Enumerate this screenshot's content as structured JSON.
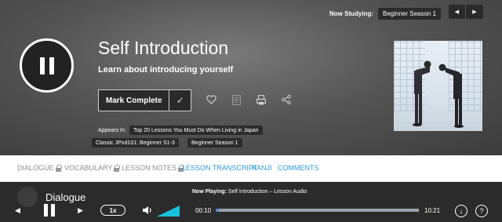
{
  "header": {
    "now_studying_label": "Now Studying:",
    "now_studying_value": "Beginner Season 1",
    "prev_icon": "chevron-left-icon",
    "next_icon": "chevron-right-icon"
  },
  "lesson": {
    "title": "Self Introduction",
    "subtitle": "Learn about introducing yourself",
    "mark_complete_label": "Mark Complete",
    "check_icon": "✓",
    "actions": [
      "heart-icon",
      "notes-icon",
      "print-icon",
      "share-icon"
    ],
    "appears_in_label": "Appears In:",
    "appears_in": [
      "Top 20 Lessons You Must Do When Living in Japan",
      "Classic JPod101: Beginner S1-3",
      "Beginner Season 1"
    ]
  },
  "tabs": [
    {
      "label": "DIALOGUE",
      "locked": true
    },
    {
      "label": "VOCABULARY",
      "locked": true
    },
    {
      "label": "LESSON NOTES",
      "locked": true
    },
    {
      "label": "LESSON TRANSCRIPT",
      "locked": false
    },
    {
      "label": "KANJI",
      "locked": false
    },
    {
      "label": "COMMENTS",
      "locked": false
    }
  ],
  "player": {
    "ghost_title": "Dialogue",
    "now_playing_label": "Now Playing:",
    "now_playing_value": "Self Introduction – Lesson Audio",
    "speed": "1x",
    "current_time": "00:10",
    "total_time": "10:21",
    "progress": 0.016,
    "download_icon": "↓",
    "help_icon": "?",
    "colors": {
      "progress_fill": "#4f87c7",
      "progress_track": "#9aa3ad",
      "volume": "#19c2de"
    }
  },
  "colors": {
    "accent": "#2c9ad8",
    "locked_tab": "#8e8e8e",
    "dark": "#2b2b2b"
  }
}
